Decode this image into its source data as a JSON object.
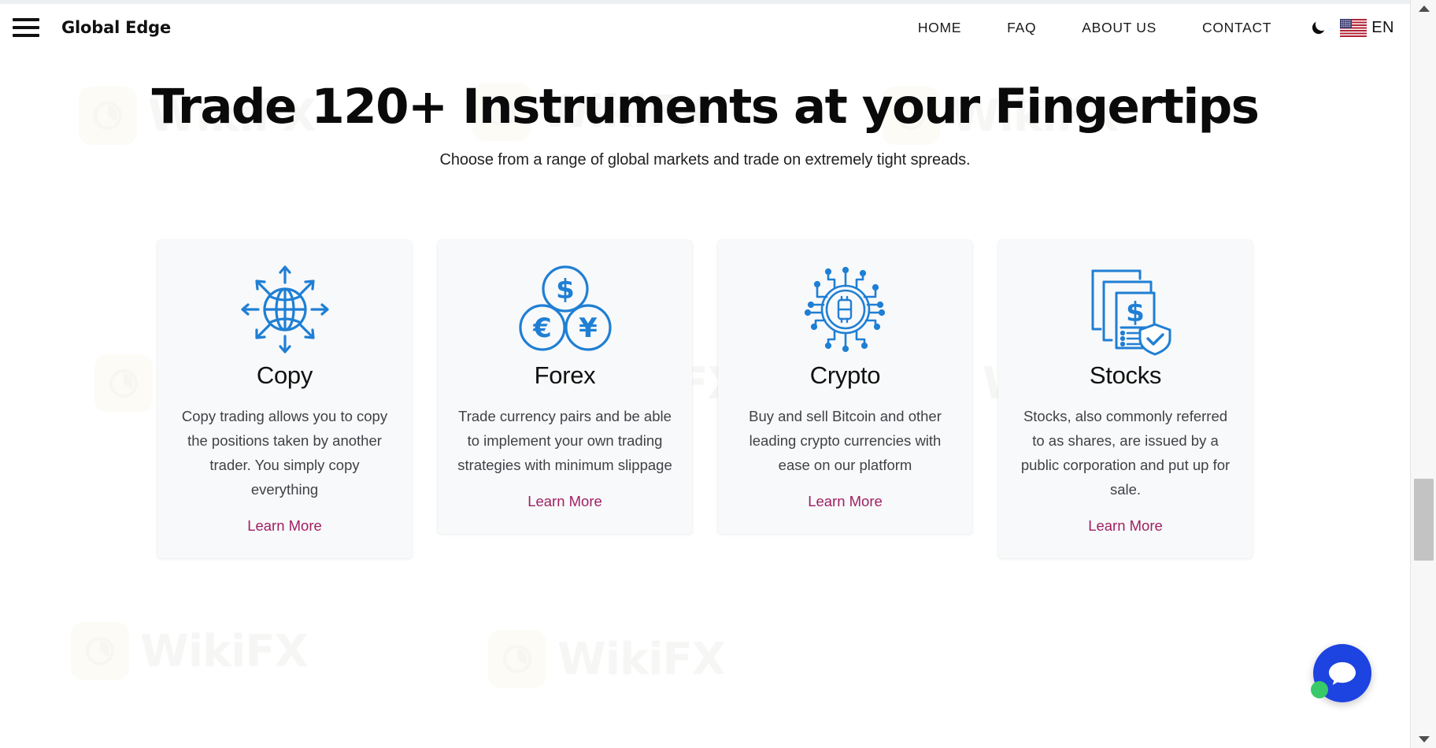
{
  "header": {
    "brand": "Global Edge",
    "menu_icon": "hamburger-icon",
    "nav": [
      {
        "label": "HOME"
      },
      {
        "label": "FAQ"
      },
      {
        "label": "ABOUT US"
      },
      {
        "label": "CONTACT"
      }
    ],
    "theme_toggle_icon": "moon-icon",
    "language": {
      "code": "EN",
      "flag": "us-flag-icon"
    }
  },
  "hero": {
    "title": "Trade 120+ Instruments at your Fingertips",
    "subtitle": "Choose from a range of global markets and trade on extremely tight spreads."
  },
  "cards": [
    {
      "icon": "globe-arrows-icon",
      "title": "Copy",
      "description": "Copy trading allows you to copy the positions taken by another trader. You simply copy everything",
      "link_label": "Learn More"
    },
    {
      "icon": "currency-coins-icon",
      "title": "Forex",
      "description": "Trade currency pairs and be able to implement your own trading strategies with minimum slippage",
      "link_label": "Learn More"
    },
    {
      "icon": "bitcoin-circuit-icon",
      "title": "Crypto",
      "description": "Buy and sell Bitcoin and other leading crypto currencies with ease on our platform",
      "link_label": "Learn More"
    },
    {
      "icon": "stock-documents-shield-icon",
      "title": "Stocks",
      "description": "Stocks, also commonly referred to as shares, are issued by a public corporation and put up for sale.",
      "link_label": "Learn More"
    }
  ],
  "chat_widget": {
    "icon": "chat-bubble-icon",
    "status": "online"
  },
  "watermarks": {
    "text": "WikiFX"
  },
  "colors": {
    "accent_blue": "#1f7fd4",
    "link_magenta": "#a02063",
    "chat_blue": "#1d43e0",
    "online_green": "#37c96a",
    "card_background": "#f8f9fa",
    "text_dark": "#111111"
  }
}
